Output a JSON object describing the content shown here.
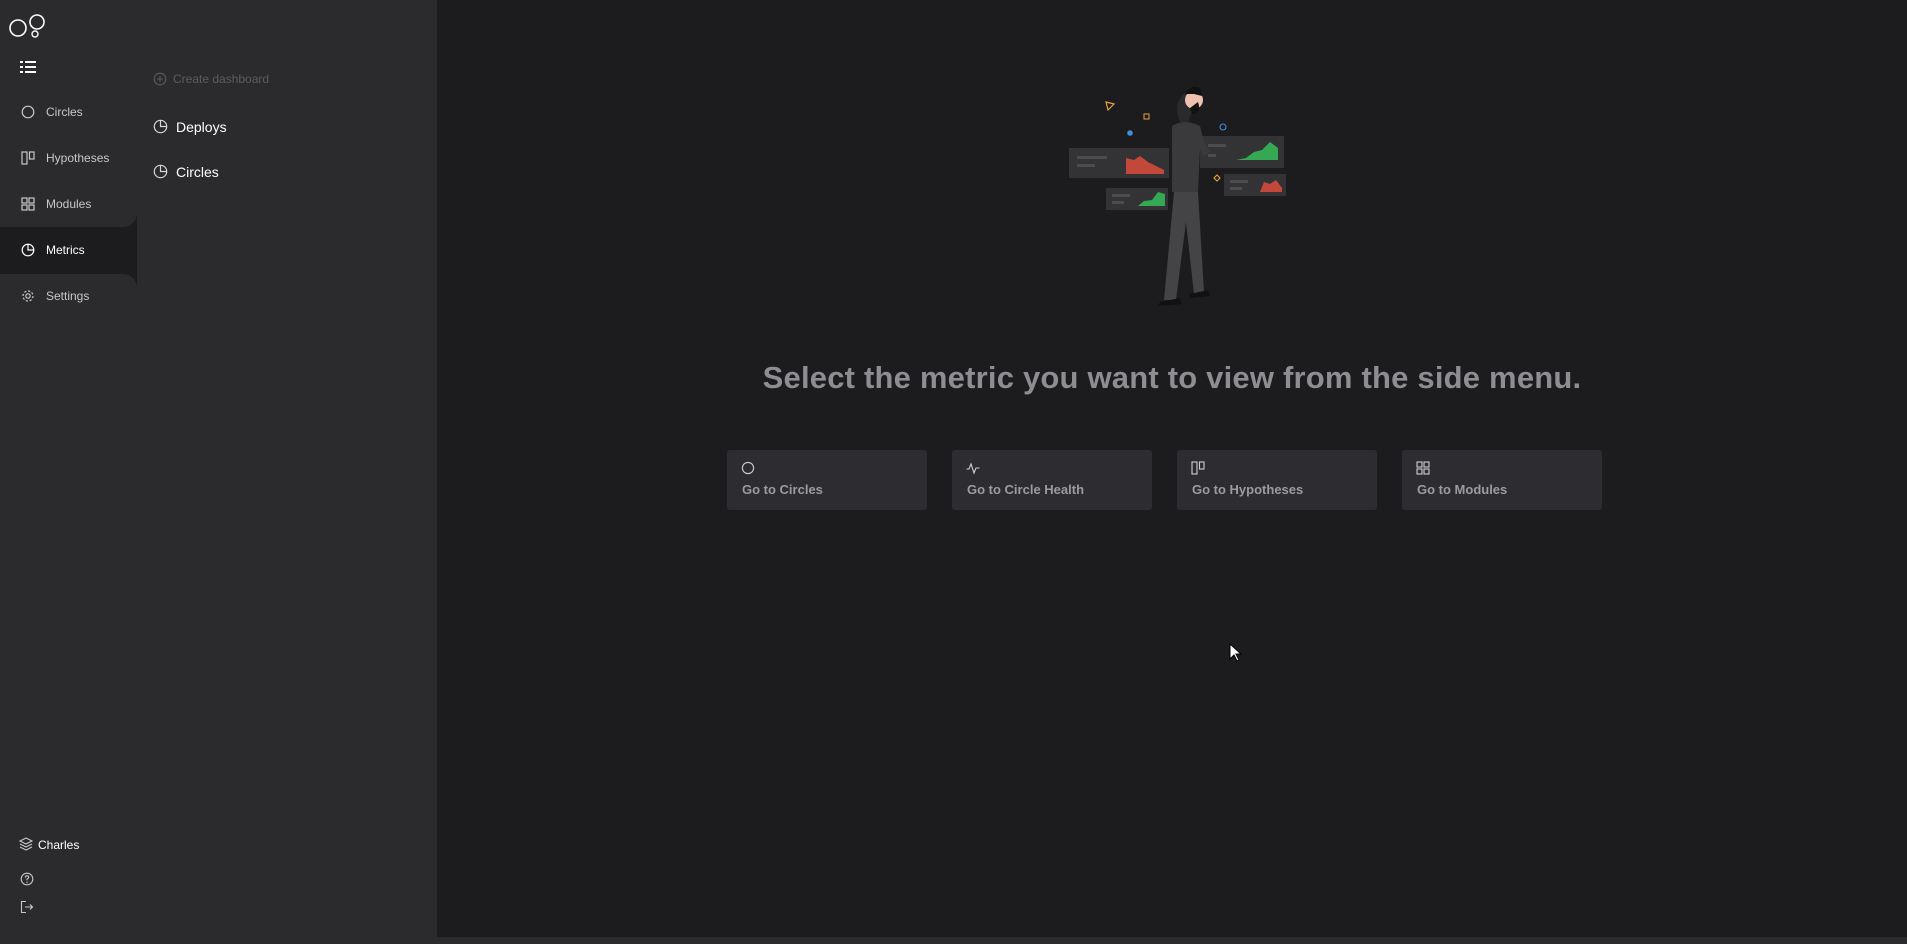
{
  "nav": {
    "items": [
      {
        "label": "Circles",
        "icon": "circle-icon"
      },
      {
        "label": "Hypotheses",
        "icon": "hypotheses-icon"
      },
      {
        "label": "Modules",
        "icon": "modules-icon"
      },
      {
        "label": "Metrics",
        "icon": "pie-chart-icon",
        "active": true
      },
      {
        "label": "Settings",
        "icon": "gear-icon"
      }
    ],
    "user": "Charles"
  },
  "side_panel": {
    "create_label": "Create dashboard",
    "dashboards": [
      {
        "label": "Deploys"
      },
      {
        "label": "Circles"
      }
    ]
  },
  "main": {
    "headline": "Select the metric you want to view from the side menu.",
    "cards": [
      {
        "label": "Go to Circles",
        "icon": "circle-icon"
      },
      {
        "label": "Go to Circle Health",
        "icon": "pulse-icon"
      },
      {
        "label": "Go to Hypotheses",
        "icon": "hypotheses-icon"
      },
      {
        "label": "Go to Modules",
        "icon": "modules-icon"
      }
    ]
  },
  "colors": {
    "background": "#1c1c1e",
    "panel": "#2b2b2e",
    "card": "#2d2d31",
    "headline": "#8d8d92"
  }
}
